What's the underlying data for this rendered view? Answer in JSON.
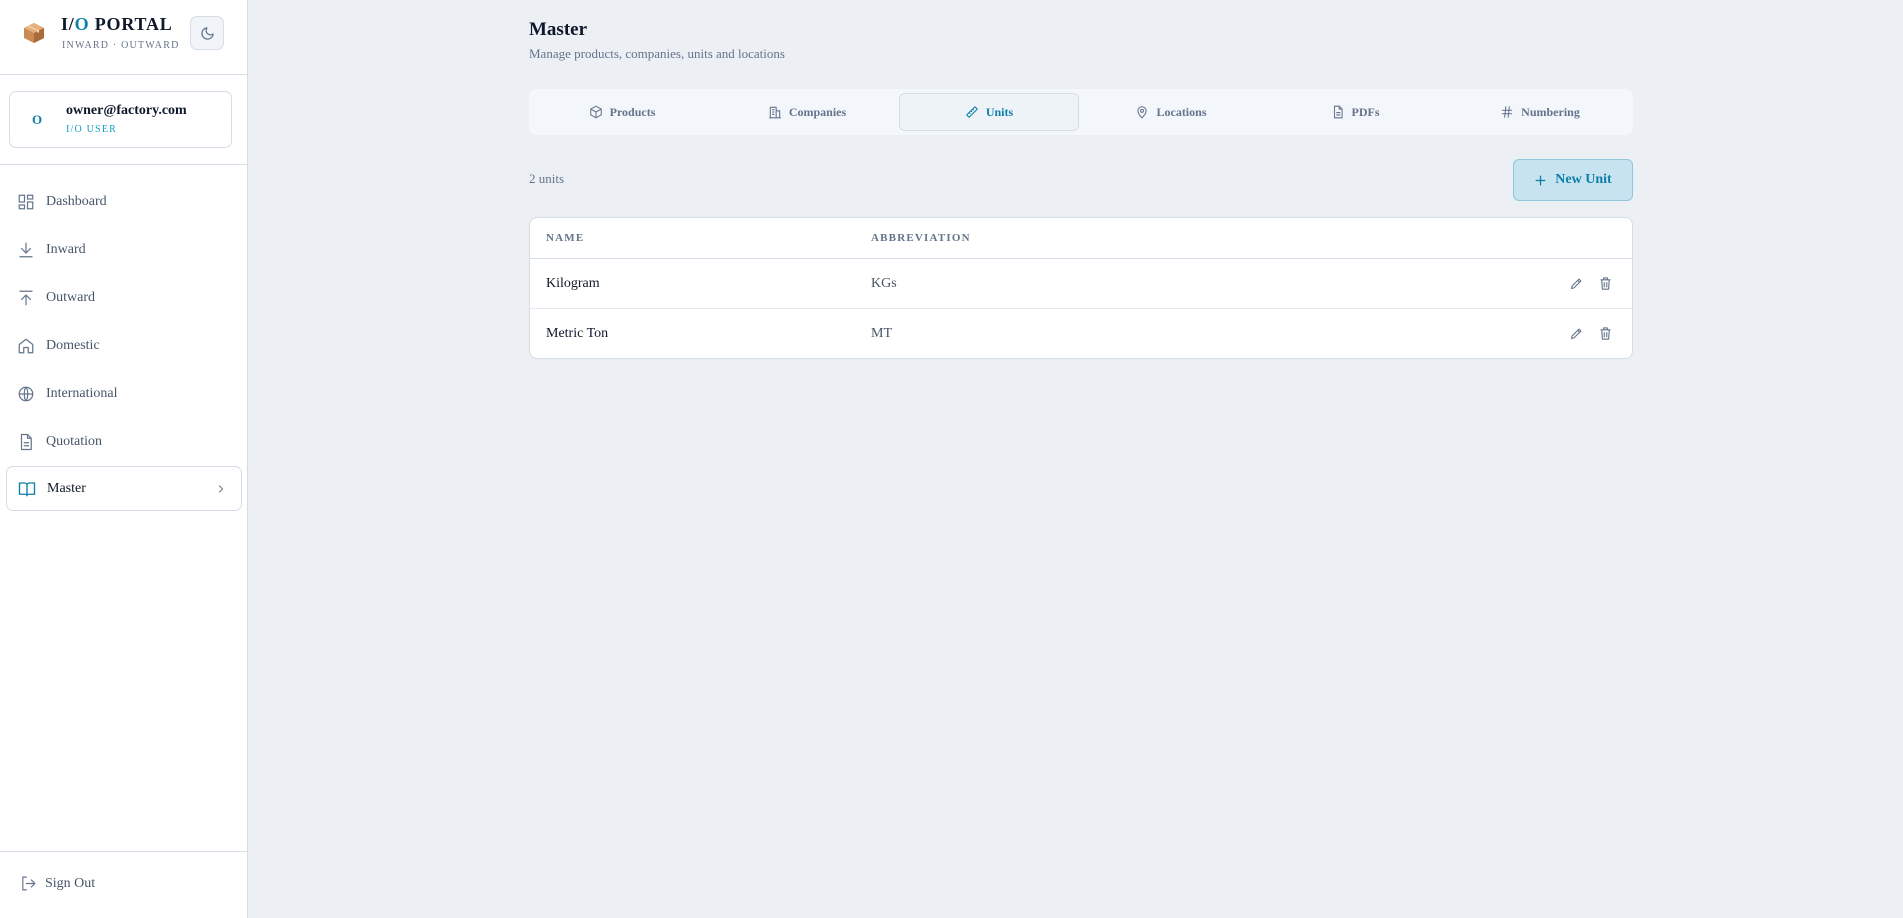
{
  "brand": {
    "title_prefix": "I/",
    "title_o": "O",
    "title_rest": " PORTAL",
    "subtitle": "INWARD · OUTWARD",
    "logo_icon": "package-box-icon",
    "theme_icon": "moon-icon"
  },
  "user": {
    "avatar_initial": "O",
    "email": "owner@factory.com",
    "role": "I/O USER"
  },
  "nav": {
    "items": [
      {
        "label": "Dashboard",
        "icon": "dashboard-grid-icon"
      },
      {
        "label": "Inward",
        "icon": "arrow-down-tray-icon"
      },
      {
        "label": "Outward",
        "icon": "arrow-up-tray-icon"
      },
      {
        "label": "Domestic",
        "icon": "home-icon"
      },
      {
        "label": "International",
        "icon": "globe-icon"
      },
      {
        "label": "Quotation",
        "icon": "document-icon"
      },
      {
        "label": "Master",
        "icon": "book-open-icon",
        "active": true
      }
    ],
    "signout": "Sign Out"
  },
  "page": {
    "title": "Master",
    "subtitle": "Manage products, companies, units and locations"
  },
  "tabs": [
    {
      "label": "Products",
      "icon": "package-icon"
    },
    {
      "label": "Companies",
      "icon": "building-icon"
    },
    {
      "label": "Units",
      "icon": "ruler-icon",
      "active": true
    },
    {
      "label": "Locations",
      "icon": "map-pin-icon"
    },
    {
      "label": "PDFs",
      "icon": "file-text-icon"
    },
    {
      "label": "Numbering",
      "icon": "hash-icon"
    }
  ],
  "toolbar": {
    "count": "2 units",
    "new_button": "New Unit"
  },
  "table": {
    "headers": [
      "NAME",
      "ABBREVIATION"
    ],
    "rows": [
      {
        "name": "Kilogram",
        "abbreviation": "KGs"
      },
      {
        "name": "Metric Ton",
        "abbreviation": "MT"
      }
    ]
  },
  "colors": {
    "accent": "#0e7fa8",
    "background": "#ecf0f5",
    "sidebar": "#ffffff",
    "border": "#d6dde7"
  }
}
